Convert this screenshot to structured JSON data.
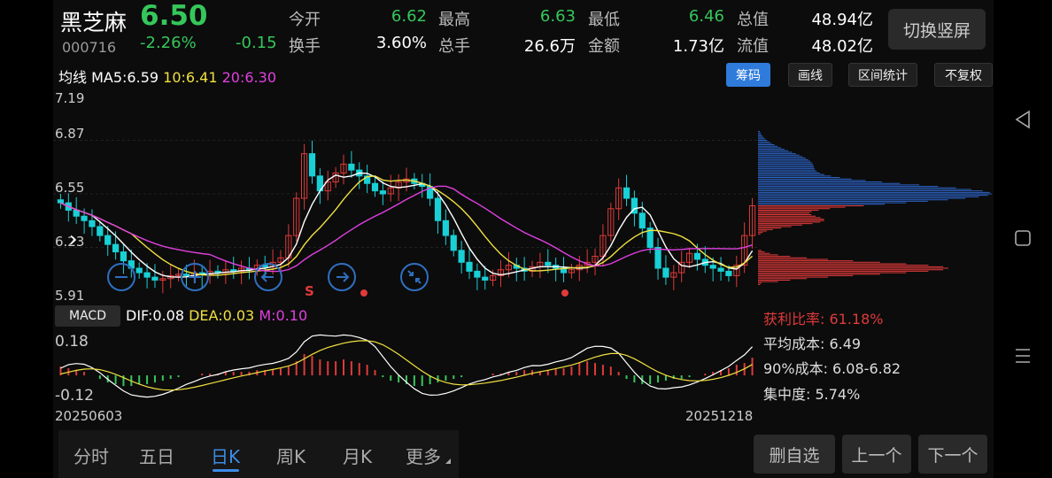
{
  "header": {
    "name": "黑芝麻",
    "code": "000716",
    "price": "6.50",
    "change_pct": "-2.26%",
    "change": "-0.15",
    "stats": [
      {
        "label": "今开",
        "value": "6.62",
        "color": "#35c75a"
      },
      {
        "label": "最高",
        "value": "6.63",
        "color": "#35c75a"
      },
      {
        "label": "最低",
        "value": "6.46",
        "color": "#35c75a"
      },
      {
        "label": "总值",
        "value": "48.94亿",
        "color": "#ffffff"
      },
      {
        "label": "换手",
        "value": "3.60%",
        "color": "#ffffff"
      },
      {
        "label": "总手",
        "value": "26.6万",
        "color": "#ffffff"
      },
      {
        "label": "金额",
        "value": "1.73亿",
        "color": "#ffffff"
      },
      {
        "label": "流值",
        "value": "48.02亿",
        "color": "#ffffff"
      }
    ],
    "switch_button": "切换竖屏"
  },
  "ma_line": {
    "label": "均线",
    "ma5": "MA5:6.59",
    "ma10": "10:6.41",
    "ma20": "20:6.30"
  },
  "toolbar": [
    "筹码",
    "画线",
    "区间统计",
    "不复权"
  ],
  "price_axis": [
    "7.19",
    "6.87",
    "6.55",
    "6.23",
    "5.91"
  ],
  "signal_mark": "S",
  "macd": {
    "button": "MACD",
    "dif": "DIF:0.08",
    "dea": "DEA:0.03",
    "m": "M:0.10",
    "axis_top": "0.18",
    "axis_bottom": "-0.12"
  },
  "dates": {
    "start": "20250603",
    "end": "20251218"
  },
  "chip_stats": {
    "profit_ratio": "获利比率: 61.18%",
    "avg_cost": "平均成本: 6.49",
    "cost_90": "90%成本: 6.08-6.82",
    "concentration": "集中度: 5.74%"
  },
  "tabs": [
    "分时",
    "五日",
    "日K",
    "周K",
    "月K",
    "更多"
  ],
  "active_tab": "日K",
  "bottom_buttons": [
    "删自选",
    "上一个",
    "下一个"
  ],
  "colors": {
    "up": "#e03a3a",
    "down": "#18d0d6",
    "green": "#35c75a",
    "accent": "#2f7bdc",
    "ma5": "#ffffff",
    "ma10": "#f0e040",
    "ma20": "#e040e0"
  },
  "chart_data": {
    "type": "candlestick",
    "close": [
      6.52,
      6.47,
      6.43,
      6.4,
      6.36,
      6.3,
      6.24,
      6.19,
      6.13,
      6.08,
      6.05,
      6.02,
      6.0,
      6.01,
      6.03,
      6.04,
      6.03,
      6.05,
      6.04,
      6.06,
      6.05,
      6.07,
      6.06,
      6.08,
      6.07,
      6.1,
      6.09,
      6.12,
      6.15,
      6.3,
      6.55,
      6.85,
      6.7,
      6.6,
      6.66,
      6.72,
      6.78,
      6.74,
      6.7,
      6.65,
      6.6,
      6.58,
      6.62,
      6.66,
      6.68,
      6.65,
      6.63,
      6.55,
      6.4,
      6.3,
      6.2,
      6.12,
      6.06,
      6.02,
      6.0,
      6.03,
      6.07,
      6.1,
      6.08,
      6.06,
      6.09,
      6.12,
      6.1,
      6.08,
      6.05,
      6.07,
      6.1,
      6.12,
      6.16,
      6.3,
      6.48,
      6.62,
      6.55,
      6.45,
      6.35,
      6.22,
      6.08,
      6.02,
      6.05,
      6.12,
      6.18,
      6.14,
      6.1,
      6.08,
      6.06,
      6.03,
      6.1,
      6.3,
      6.5
    ],
    "macd_hist": [
      0.05,
      0.04,
      0.03,
      0.02,
      0.0,
      -0.02,
      -0.04,
      -0.05,
      -0.06,
      -0.06,
      -0.05,
      -0.05,
      -0.04,
      -0.03,
      -0.02,
      -0.01,
      0.0,
      0.0,
      0.01,
      0.01,
      0.01,
      0.02,
      0.02,
      0.02,
      0.02,
      0.03,
      0.03,
      0.03,
      0.04,
      0.05,
      0.08,
      0.12,
      0.11,
      0.09,
      0.08,
      0.08,
      0.09,
      0.08,
      0.07,
      0.06,
      0.03,
      -0.01,
      -0.03,
      -0.04,
      -0.05,
      -0.06,
      -0.06,
      -0.05,
      -0.04,
      -0.03,
      -0.02,
      -0.01,
      0.0,
      0.0,
      0.0,
      0.01,
      0.01,
      0.02,
      0.02,
      0.03,
      0.03,
      0.02,
      0.03,
      0.04,
      0.04,
      0.05,
      0.07,
      0.08,
      0.07,
      0.06,
      0.05,
      0.02,
      -0.02,
      -0.04,
      -0.05,
      -0.05,
      -0.04,
      -0.03,
      -0.02,
      -0.02,
      -0.01,
      0.0,
      0.01,
      0.02,
      0.03,
      0.04,
      0.06,
      0.07,
      0.1
    ]
  }
}
